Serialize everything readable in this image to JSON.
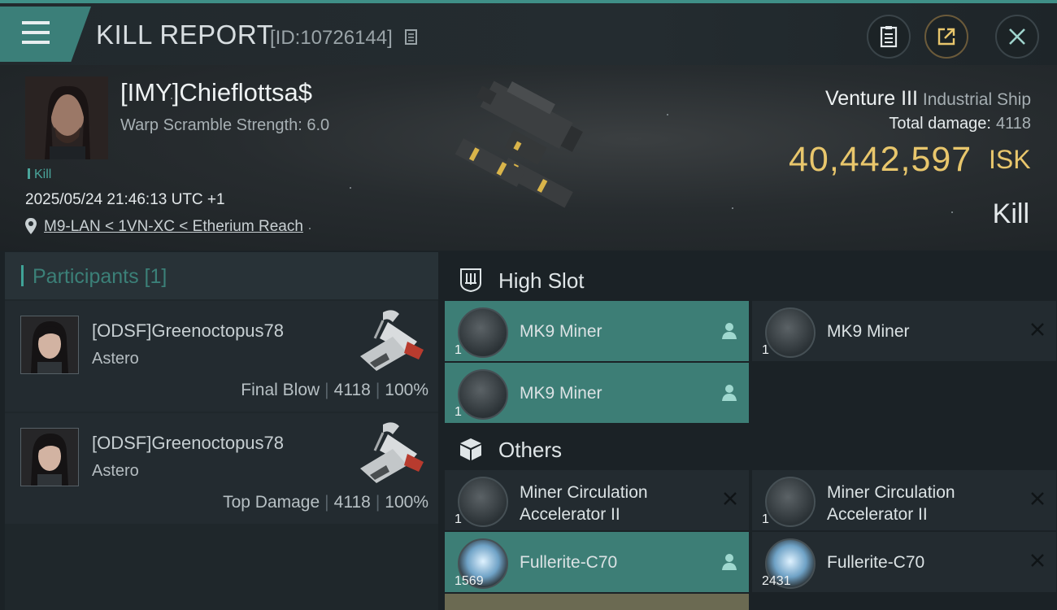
{
  "topbar": {
    "title": "KILL REPORT",
    "report_id": "[ID:10726144]"
  },
  "victim": {
    "name": "[IMY]Chieflottsa$",
    "warp_scramble": "Warp Scramble Strength: 6.0",
    "tag": "Kill",
    "timestamp": "2025/05/24 21:46:13 UTC +1",
    "location": "M9-LAN < 1VN-XC < Etherium Reach",
    "ship_name": "Venture III",
    "ship_class": "Industrial Ship",
    "total_damage_label": "Total damage:",
    "total_damage": "4118",
    "isk_value": "40,442,597",
    "isk_unit": "ISK",
    "result": "Kill"
  },
  "participants": {
    "label": "Participants [1]",
    "rows": [
      {
        "name": "[ODSF]Greenoctopus78",
        "ship": "Astero",
        "role": "Final Blow",
        "damage": "4118",
        "percent": "100%"
      },
      {
        "name": "[ODSF]Greenoctopus78",
        "ship": "Astero",
        "role": "Top Damage",
        "damage": "4118",
        "percent": "100%"
      }
    ]
  },
  "high_slot": {
    "title": "High Slot",
    "items": [
      {
        "name": "MK9 Miner",
        "qty": "1",
        "state": "user-icon"
      },
      {
        "name": "MK9 Miner",
        "qty": "1",
        "state": "close-icon"
      },
      {
        "name": "MK9 Miner",
        "qty": "1",
        "state": "user-icon"
      }
    ]
  },
  "others": {
    "title": "Others",
    "items": [
      {
        "name_line1": "Miner Circulation",
        "name_line2": "Accelerator II",
        "qty": "1",
        "state": "close-icon"
      },
      {
        "name_line1": "Miner Circulation",
        "name_line2": "Accelerator II",
        "qty": "1",
        "state": "close-icon"
      },
      {
        "name": "Fullerite-C70",
        "qty": "1569",
        "state": "user-icon"
      },
      {
        "name": "Fullerite-C70",
        "qty": "2431",
        "state": "close-icon"
      }
    ]
  },
  "colors": {
    "accent": "#3d7e76",
    "isk": "#e8c66c",
    "panel": "#232b30"
  }
}
